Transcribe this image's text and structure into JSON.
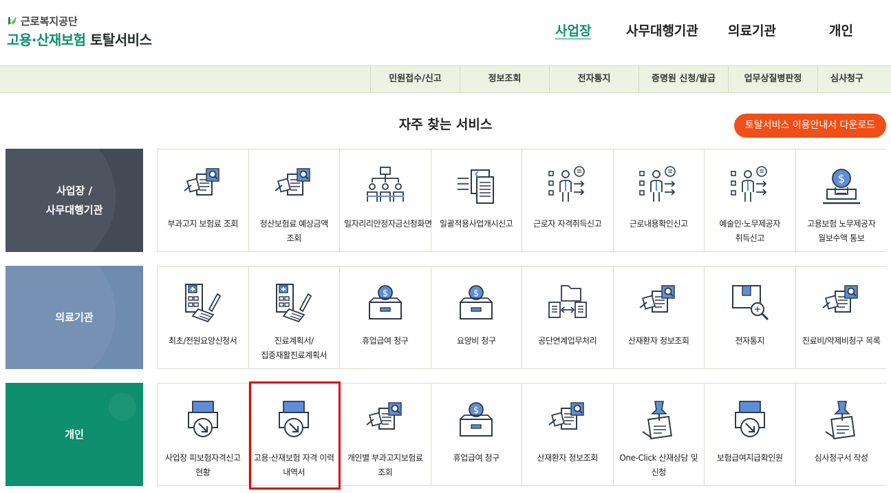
{
  "logo": {
    "org_name": "근로복지공단",
    "service_name_green": "고용·산재보험",
    "service_name_dark": " 토탈서비스"
  },
  "main_nav": [
    {
      "label": "사업장",
      "active": true
    },
    {
      "label": "사무대행기관",
      "active": false
    },
    {
      "label": "의료기관",
      "active": false
    },
    {
      "label": "개인",
      "active": false
    }
  ],
  "sub_nav": [
    "민원접수/신고",
    "정보조회",
    "전자통지",
    "증명원 신청/발급",
    "업무상질병판정",
    "심사청구"
  ],
  "section": {
    "title": "자주 찾는 서비스",
    "download_label": "토탈서비스 이용안내서 다운로드"
  },
  "colors": {
    "brand_green": "#0b8f6c",
    "accent_orange": "#f04f17",
    "icon_blue": "#5e8fd6",
    "highlight_red": "#e0000f"
  },
  "rows": [
    {
      "category": [
        "사업장 /",
        "사무대행기관"
      ],
      "color": "#434a55",
      "tiles": [
        {
          "label": "부과고지 보험료 조회",
          "icon": "document-search-icon"
        },
        {
          "label": "정산보험료 예상금액 조회",
          "icon": "document-search-icon"
        },
        {
          "label": "일자리리안정자금신청화면안내",
          "icon": "org-chart-icon"
        },
        {
          "label": "일괄적용사업개시신고",
          "icon": "document-transfer-icon"
        },
        {
          "label": "근로자 자격취득신고",
          "icon": "person-checklist-icon"
        },
        {
          "label": "근로내용확인신고",
          "icon": "person-checklist-icon"
        },
        {
          "label": "예술인·노무제공자 취득신고",
          "icon": "person-checklist-icon"
        },
        {
          "label": "고용보험 노무제공자 월보수액 통보",
          "icon": "money-report-icon"
        }
      ]
    },
    {
      "category": [
        "의료기관"
      ],
      "color": "#6e8bb0",
      "tiles": [
        {
          "label": "최초/전원요양신청서",
          "icon": "hospital-document-icon"
        },
        {
          "label": "진료계획서/집중재활진료계획서",
          "icon": "hospital-document-icon"
        },
        {
          "label": "휴업급여 청구",
          "icon": "money-box-icon"
        },
        {
          "label": "요양비 청구",
          "icon": "money-box-icon"
        },
        {
          "label": "공단연계업무처리",
          "icon": "document-exchange-icon"
        },
        {
          "label": "산재환자 정보조회",
          "icon": "document-search-icon"
        },
        {
          "label": "전자통지",
          "icon": "box-search-icon"
        },
        {
          "label": "진료비/약제비청구 목록",
          "icon": "document-search-icon"
        }
      ]
    },
    {
      "category": [
        "개인"
      ],
      "color": "#0e8f6f",
      "tiles": [
        {
          "label": "사업장 피보험자격신고 현황",
          "icon": "printer-download-icon"
        },
        {
          "label": "고용·산재보험 자격 이력 내역서",
          "icon": "printer-download-icon"
        },
        {
          "label": "개인별 부과고지보험료 조회",
          "icon": "document-search-icon"
        },
        {
          "label": "휴업급여 청구",
          "icon": "money-box-icon"
        },
        {
          "label": "산재환자 정보조회",
          "icon": "document-search-icon"
        },
        {
          "label": "One-Click 산재상담 및 신청",
          "icon": "pin-document-icon"
        },
        {
          "label": "보험급여지급확인원",
          "icon": "printer-download-icon"
        },
        {
          "label": "심사청구서 작성",
          "icon": "pin-document-icon"
        }
      ]
    }
  ]
}
